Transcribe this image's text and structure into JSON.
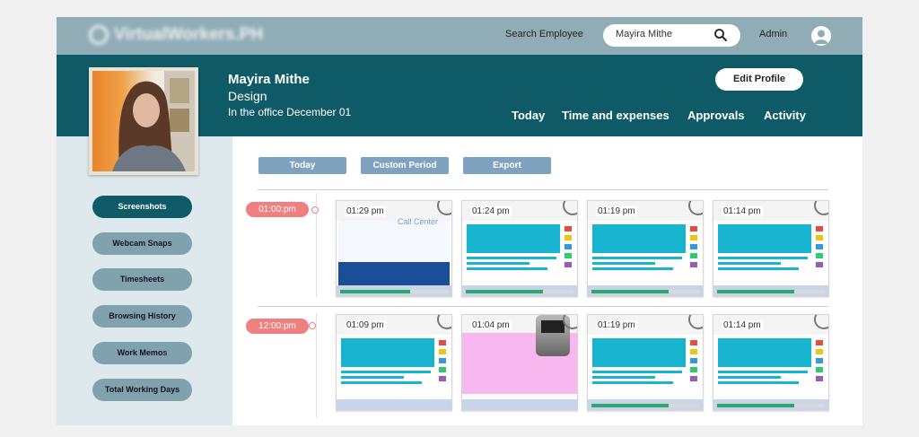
{
  "topbar": {
    "logo_text": "VirtualWorkers.PH",
    "search_label": "Search Employee",
    "search_value": "Mayira Mithe",
    "admin_label": "Admin"
  },
  "profile": {
    "name": "Mayira Mithe",
    "department": "Design",
    "status": "In the office December 01",
    "edit_label": "Edit Profile"
  },
  "nav": [
    "Today",
    "Time and expenses",
    "Approvals",
    "Activity"
  ],
  "sidebar": [
    {
      "label": "Screenshots",
      "active": true
    },
    {
      "label": "Webcam Snaps",
      "active": false
    },
    {
      "label": "Timesheets",
      "active": false
    },
    {
      "label": "Browsing History",
      "active": false
    },
    {
      "label": "Work Memos",
      "active": false
    },
    {
      "label": "Total Working Days",
      "active": false
    }
  ],
  "filters": [
    "Today",
    "Custom Period",
    "Export"
  ],
  "timeline": [
    {
      "time": "01:00:pm",
      "shots": [
        {
          "time": "01:29 pm",
          "kind": "callcenter",
          "progress": 0.65,
          "title": "Call Center"
        },
        {
          "time": "01:24 pm",
          "kind": "cyan",
          "progress": 0.72
        },
        {
          "time": "01:19 pm",
          "kind": "cyan",
          "progress": 0.72
        },
        {
          "time": "01:14 pm",
          "kind": "cyan",
          "progress": 0.72
        }
      ]
    },
    {
      "time": "12:00:pm",
      "shots": [
        {
          "time": "01:09 pm",
          "kind": "cyan",
          "progress": 0.0
        },
        {
          "time": "01:04 pm",
          "kind": "pink",
          "progress": 0.0
        },
        {
          "time": "01:19 pm",
          "kind": "cyan",
          "progress": 0.72
        },
        {
          "time": "01:14 pm",
          "kind": "cyan",
          "progress": 0.72
        }
      ]
    }
  ],
  "colors": {
    "topbar": "#90adb5",
    "banner": "#0f5a67",
    "sidebar": "#dde9ec",
    "time_pill": "#f08080",
    "filter_btn": "#7fa2c0"
  }
}
